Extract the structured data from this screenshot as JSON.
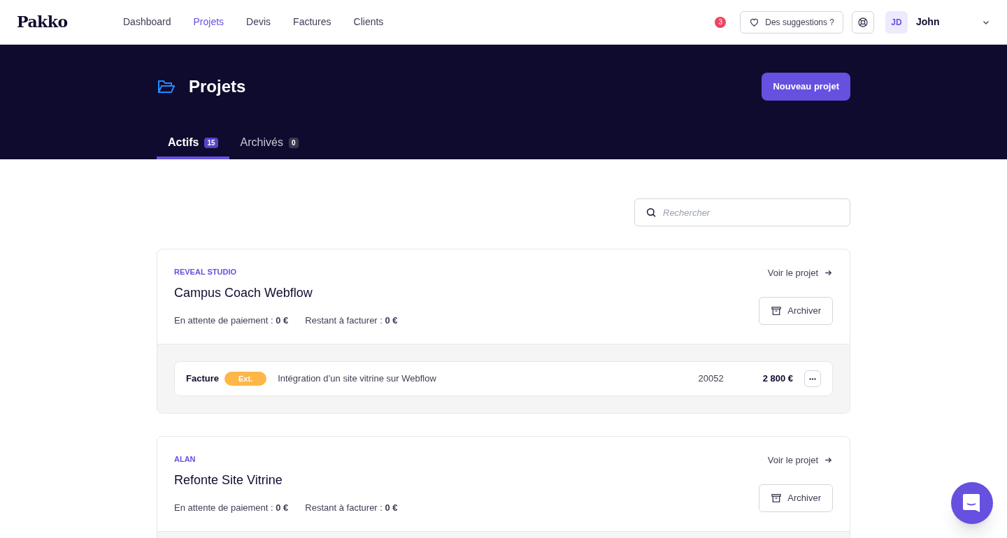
{
  "brand": "Pakko",
  "nav": [
    {
      "label": "Dashboard",
      "selected": false
    },
    {
      "label": "Projets",
      "selected": true
    },
    {
      "label": "Devis",
      "selected": false
    },
    {
      "label": "Factures",
      "selected": false
    },
    {
      "label": "Clients",
      "selected": false
    }
  ],
  "notifications": "3",
  "suggestions_button": "Des suggestions ?",
  "user": {
    "initials": "JD",
    "name": "John"
  },
  "header": {
    "title": "Projets",
    "new_button": "Nouveau projet"
  },
  "tabs": [
    {
      "label": "Actifs",
      "count": "15",
      "selected": true
    },
    {
      "label": "Archivés",
      "count": "0",
      "selected": false
    }
  ],
  "search": {
    "placeholder": "Rechercher"
  },
  "projects": [
    {
      "client": "REVEAL STUDIO",
      "name": "Campus Coach Webflow",
      "stats": [
        "En attente de paiement : **0 €**",
        "Restant à facturer : **0 €**"
      ],
      "view_link": "Voir le projet",
      "archive_button": "Archiver",
      "documents": [
        {
          "type": "Facture",
          "tag": "Ext.",
          "description": "Intégration d’un site vitrine sur Webflow",
          "number": "20052",
          "amount": "2 800 €"
        }
      ]
    },
    {
      "client": "ALAN",
      "name": "Refonte Site Vitrine",
      "stats": [
        "En attente de paiement : **0 €**",
        "Restant à facturer : **0 €**"
      ],
      "view_link": "Voir le projet",
      "archive_button": "Archiver"
    }
  ]
}
